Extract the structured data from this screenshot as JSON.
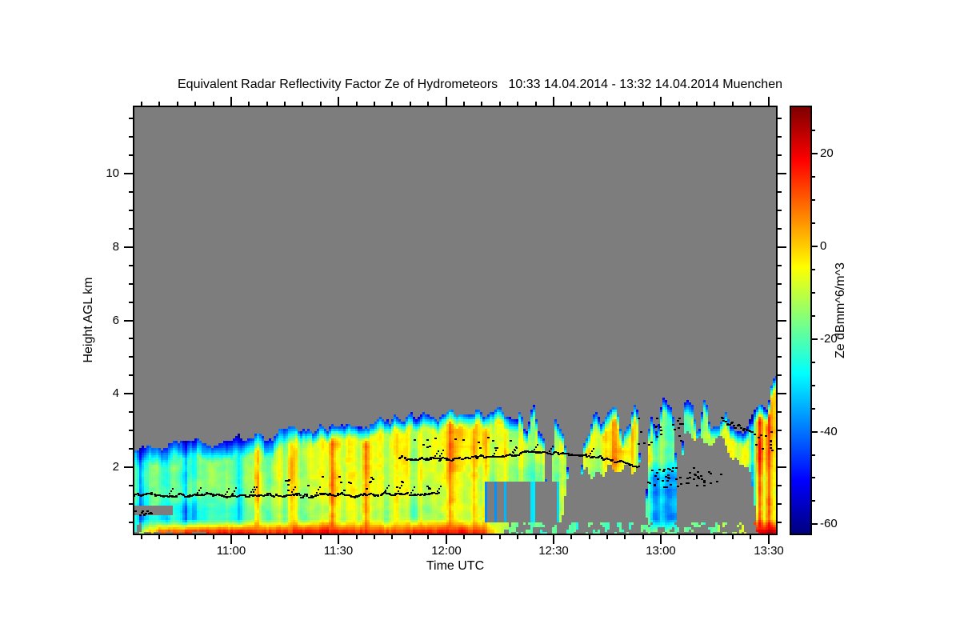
{
  "title": "Equivalent Radar Reflectivity Factor Ze of Hydrometeors   10:33 14.04.2014 - 13:32 14.04.2014 Muenchen",
  "chart_data": {
    "type": "heatmap",
    "title": "Equivalent Radar Reflectivity Factor Ze of Hydrometeors   10:33 14.04.2014 - 13:32 14.04.2014 Muenchen",
    "station": "Muenchen",
    "time_start": "10:33 14.04.2014",
    "time_end": "13:32 14.04.2014",
    "xlabel": "Time UTC",
    "ylabel": "Height AGL km",
    "colorbar_label": "Ze dBmm^6/m^3",
    "x_range_hours": [
      10.55,
      13.535
    ],
    "y_range_km": [
      0.2,
      11.8
    ],
    "x_ticks": [
      {
        "t": 11.0,
        "label": "11:00"
      },
      {
        "t": 11.5,
        "label": "11:30"
      },
      {
        "t": 12.0,
        "label": "12:00"
      },
      {
        "t": 12.5,
        "label": "12:30"
      },
      {
        "t": 13.0,
        "label": "13:00"
      },
      {
        "t": 13.5,
        "label": "13:30"
      }
    ],
    "x_minor_step_min": 5,
    "y_ticks": [
      {
        "v": 2,
        "label": "2"
      },
      {
        "v": 4,
        "label": "4"
      },
      {
        "v": 6,
        "label": "6"
      },
      {
        "v": 8,
        "label": "8"
      },
      {
        "v": 10,
        "label": "10"
      }
    ],
    "y_minor_step_km": 0.5,
    "colorbar": {
      "min": -62,
      "max": 30,
      "ticks": [
        {
          "v": 20,
          "label": "20"
        },
        {
          "v": 0,
          "label": "0"
        },
        {
          "v": -20,
          "label": "-20"
        },
        {
          "v": -40,
          "label": "-40"
        },
        {
          "v": -60,
          "label": "-60"
        }
      ],
      "minor_step": 5,
      "colormap": "jet"
    },
    "no_data_color": "#7d7d7d",
    "dot_color": "#000000",
    "echo_top_km": [
      [
        10.55,
        2.5
      ],
      [
        10.8,
        2.62
      ],
      [
        11.0,
        2.78
      ],
      [
        11.2,
        2.92
      ],
      [
        11.4,
        3.05
      ],
      [
        11.6,
        3.2
      ],
      [
        11.8,
        3.32
      ],
      [
        12.0,
        3.42
      ],
      [
        12.15,
        3.5
      ],
      [
        12.3,
        3.42
      ],
      [
        12.45,
        3.28
      ],
      [
        12.6,
        3.05
      ],
      [
        12.7,
        3.15
      ],
      [
        12.8,
        3.3
      ],
      [
        12.87,
        3.55
      ],
      [
        12.95,
        3.45
      ],
      [
        13.05,
        3.5
      ],
      [
        13.12,
        3.45
      ],
      [
        13.2,
        3.35
      ],
      [
        13.3,
        3.35
      ],
      [
        13.38,
        3.3
      ],
      [
        13.44,
        3.7
      ],
      [
        13.5,
        4.1
      ],
      [
        13.535,
        4.25
      ]
    ],
    "echo_base_km": [
      [
        10.55,
        0.2
      ],
      [
        12.52,
        0.2
      ],
      [
        12.58,
        1.85
      ],
      [
        12.75,
        1.95
      ],
      [
        12.9,
        2.0
      ],
      [
        12.94,
        0.2
      ],
      [
        13.07,
        0.2
      ],
      [
        13.11,
        2.75
      ],
      [
        13.29,
        2.75
      ],
      [
        13.33,
        2.15
      ],
      [
        13.41,
        2.2
      ],
      [
        13.45,
        0.2
      ],
      [
        13.535,
        0.2
      ]
    ],
    "core_dbz": [
      [
        10.55,
        -22
      ],
      [
        10.8,
        -19
      ],
      [
        11.0,
        -15
      ],
      [
        11.2,
        -11
      ],
      [
        11.4,
        -9
      ],
      [
        11.6,
        -8
      ],
      [
        11.8,
        -7
      ],
      [
        12.0,
        -6
      ],
      [
        12.2,
        -7
      ],
      [
        12.35,
        -8
      ],
      [
        12.5,
        -9
      ],
      [
        12.65,
        -8
      ],
      [
        12.8,
        -7
      ],
      [
        12.93,
        -13
      ],
      [
        13.05,
        -16
      ],
      [
        13.15,
        -14
      ],
      [
        13.3,
        -11
      ],
      [
        13.42,
        -3
      ],
      [
        13.5,
        1
      ],
      [
        13.535,
        0
      ]
    ],
    "surface_band_dbz": [
      [
        10.55,
        -25
      ],
      [
        10.6,
        -5
      ],
      [
        10.68,
        8
      ],
      [
        10.8,
        11
      ],
      [
        11.0,
        13
      ],
      [
        11.15,
        10
      ],
      [
        11.3,
        12
      ],
      [
        11.45,
        16
      ],
      [
        11.6,
        10
      ],
      [
        11.75,
        9
      ],
      [
        11.9,
        12
      ],
      [
        12.05,
        14
      ],
      [
        12.15,
        11
      ],
      [
        12.22,
        0
      ],
      [
        12.3,
        -18
      ],
      [
        12.5,
        -22
      ],
      [
        12.8,
        -20
      ],
      [
        13.0,
        -16
      ],
      [
        13.2,
        -20
      ],
      [
        13.32,
        -12
      ],
      [
        13.4,
        -2
      ],
      [
        13.45,
        15
      ],
      [
        13.5,
        20
      ],
      [
        13.535,
        18
      ]
    ],
    "melting_line_km": [
      [
        10.55,
        1.25
      ],
      [
        11.95,
        1.3
      ],
      [
        12.05,
        2.3
      ],
      [
        12.6,
        2.4
      ],
      [
        12.9,
        2.2
      ],
      [
        13.535,
        2.2
      ]
    ],
    "cooling_amp_dbz": [
      [
        10.55,
        9
      ],
      [
        10.9,
        9
      ],
      [
        11.15,
        5
      ],
      [
        11.5,
        4
      ],
      [
        12.0,
        5
      ],
      [
        12.5,
        6
      ],
      [
        12.9,
        6
      ],
      [
        12.95,
        18
      ],
      [
        13.07,
        18
      ],
      [
        13.1,
        4
      ],
      [
        13.535,
        4
      ]
    ],
    "updraft_streaks": [
      [
        10.98,
        8
      ],
      [
        11.12,
        10
      ],
      [
        11.28,
        7
      ],
      [
        11.47,
        14
      ],
      [
        11.63,
        9
      ],
      [
        11.77,
        8
      ],
      [
        11.88,
        9
      ],
      [
        12.02,
        11
      ],
      [
        12.13,
        9
      ],
      [
        12.18,
        8
      ],
      [
        12.28,
        7
      ],
      [
        12.47,
        7
      ],
      [
        12.78,
        9
      ],
      [
        12.87,
        11
      ],
      [
        12.95,
        9
      ],
      [
        13.0,
        7
      ],
      [
        13.16,
        6
      ],
      [
        13.46,
        14
      ],
      [
        13.5,
        15
      ]
    ],
    "cold_streaks": [
      [
        10.58,
        14
      ],
      [
        10.79,
        12
      ],
      [
        11.04,
        10
      ],
      [
        12.335,
        10
      ],
      [
        12.41,
        8
      ],
      [
        13.425,
        20
      ]
    ],
    "top_notches": [
      [
        12.48,
        0.015
      ],
      [
        12.605,
        0.03
      ],
      [
        12.92,
        0.018
      ],
      [
        13.085,
        0.015
      ]
    ],
    "no_echo_gaps": [
      {
        "t": [
          10.55,
          10.73
        ],
        "h": [
          0.68,
          0.97
        ]
      },
      {
        "t": [
          12.18,
          12.53
        ],
        "h": [
          0.5,
          1.62
        ],
        "porosity": 0.4
      }
    ],
    "melting_layer_dots": [
      {
        "name": "lower-line",
        "type": "line",
        "t": [
          10.55,
          11.97
        ],
        "pts": [
          [
            10.55,
            1.28
          ],
          [
            10.7,
            1.22
          ],
          [
            10.85,
            1.26
          ],
          [
            11.0,
            1.22
          ],
          [
            11.15,
            1.26
          ],
          [
            11.3,
            1.22
          ],
          [
            11.45,
            1.26
          ],
          [
            11.6,
            1.23
          ],
          [
            11.75,
            1.28
          ],
          [
            11.85,
            1.27
          ],
          [
            11.97,
            1.33
          ]
        ],
        "count": 240,
        "wiggle": 0.05,
        "spike_p": 0.07
      },
      {
        "name": "lower-scatter",
        "type": "scatter",
        "t": [
          11.2,
          12.02
        ],
        "h": [
          1.35,
          1.75
        ],
        "count": 24
      },
      {
        "name": "upper-line",
        "type": "line",
        "t": [
          11.78,
          12.9
        ],
        "pts": [
          [
            11.78,
            2.26
          ],
          [
            11.95,
            2.22
          ],
          [
            12.1,
            2.26
          ],
          [
            12.25,
            2.31
          ],
          [
            12.4,
            2.42
          ],
          [
            12.55,
            2.36
          ],
          [
            12.7,
            2.28
          ],
          [
            12.8,
            2.15
          ],
          [
            12.9,
            2.05
          ]
        ],
        "count": 185,
        "wiggle": 0.04,
        "spike_p": 0.04
      },
      {
        "name": "upper-scatter",
        "type": "scatter",
        "t": [
          11.85,
          12.3
        ],
        "h": [
          2.5,
          2.85
        ],
        "count": 14
      },
      {
        "name": "cell-top-scatter",
        "type": "scatter",
        "t": [
          12.88,
          13.1
        ],
        "h": [
          2.6,
          3.35
        ],
        "count": 22
      },
      {
        "name": "cell-low-scatter",
        "type": "scatter",
        "t": [
          12.93,
          13.18
        ],
        "h": [
          1.45,
          2.0
        ],
        "count": 42
      },
      {
        "name": "gap-scatter",
        "type": "scatter",
        "t": [
          13.18,
          13.3
        ],
        "h": [
          1.5,
          1.9
        ],
        "count": 10
      },
      {
        "name": "right-descend-line",
        "type": "line",
        "t": [
          13.28,
          13.43
        ],
        "pts": [
          [
            13.28,
            3.32
          ],
          [
            13.35,
            3.12
          ],
          [
            13.43,
            2.88
          ]
        ],
        "count": 26,
        "wiggle": 0.07,
        "spike_p": 0
      },
      {
        "name": "right-scatter",
        "type": "scatter",
        "t": [
          13.43,
          13.52
        ],
        "h": [
          2.4,
          3.0
        ],
        "count": 12
      },
      {
        "name": "left-ground-dots",
        "type": "scatter",
        "t": [
          10.55,
          10.64
        ],
        "h": [
          0.7,
          0.82
        ],
        "count": 12
      }
    ]
  }
}
